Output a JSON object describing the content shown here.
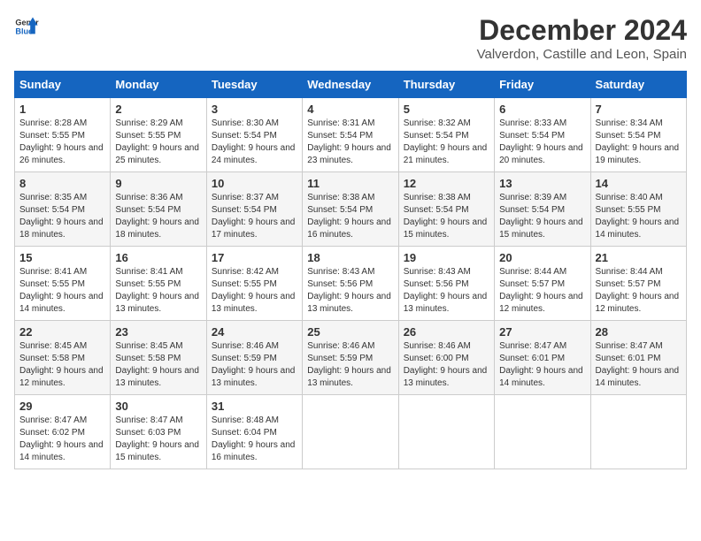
{
  "logo": {
    "text_general": "General",
    "text_blue": "Blue"
  },
  "title": "December 2024",
  "subtitle": "Valverdon, Castille and Leon, Spain",
  "days_of_week": [
    "Sunday",
    "Monday",
    "Tuesday",
    "Wednesday",
    "Thursday",
    "Friday",
    "Saturday"
  ],
  "weeks": [
    [
      {
        "day": "1",
        "sunrise": "8:28 AM",
        "sunset": "5:55 PM",
        "daylight": "9 hours and 26 minutes."
      },
      {
        "day": "2",
        "sunrise": "8:29 AM",
        "sunset": "5:55 PM",
        "daylight": "9 hours and 25 minutes."
      },
      {
        "day": "3",
        "sunrise": "8:30 AM",
        "sunset": "5:54 PM",
        "daylight": "9 hours and 24 minutes."
      },
      {
        "day": "4",
        "sunrise": "8:31 AM",
        "sunset": "5:54 PM",
        "daylight": "9 hours and 23 minutes."
      },
      {
        "day": "5",
        "sunrise": "8:32 AM",
        "sunset": "5:54 PM",
        "daylight": "9 hours and 21 minutes."
      },
      {
        "day": "6",
        "sunrise": "8:33 AM",
        "sunset": "5:54 PM",
        "daylight": "9 hours and 20 minutes."
      },
      {
        "day": "7",
        "sunrise": "8:34 AM",
        "sunset": "5:54 PM",
        "daylight": "9 hours and 19 minutes."
      }
    ],
    [
      {
        "day": "8",
        "sunrise": "8:35 AM",
        "sunset": "5:54 PM",
        "daylight": "9 hours and 18 minutes."
      },
      {
        "day": "9",
        "sunrise": "8:36 AM",
        "sunset": "5:54 PM",
        "daylight": "9 hours and 18 minutes."
      },
      {
        "day": "10",
        "sunrise": "8:37 AM",
        "sunset": "5:54 PM",
        "daylight": "9 hours and 17 minutes."
      },
      {
        "day": "11",
        "sunrise": "8:38 AM",
        "sunset": "5:54 PM",
        "daylight": "9 hours and 16 minutes."
      },
      {
        "day": "12",
        "sunrise": "8:38 AM",
        "sunset": "5:54 PM",
        "daylight": "9 hours and 15 minutes."
      },
      {
        "day": "13",
        "sunrise": "8:39 AM",
        "sunset": "5:54 PM",
        "daylight": "9 hours and 15 minutes."
      },
      {
        "day": "14",
        "sunrise": "8:40 AM",
        "sunset": "5:55 PM",
        "daylight": "9 hours and 14 minutes."
      }
    ],
    [
      {
        "day": "15",
        "sunrise": "8:41 AM",
        "sunset": "5:55 PM",
        "daylight": "9 hours and 14 minutes."
      },
      {
        "day": "16",
        "sunrise": "8:41 AM",
        "sunset": "5:55 PM",
        "daylight": "9 hours and 13 minutes."
      },
      {
        "day": "17",
        "sunrise": "8:42 AM",
        "sunset": "5:55 PM",
        "daylight": "9 hours and 13 minutes."
      },
      {
        "day": "18",
        "sunrise": "8:43 AM",
        "sunset": "5:56 PM",
        "daylight": "9 hours and 13 minutes."
      },
      {
        "day": "19",
        "sunrise": "8:43 AM",
        "sunset": "5:56 PM",
        "daylight": "9 hours and 13 minutes."
      },
      {
        "day": "20",
        "sunrise": "8:44 AM",
        "sunset": "5:57 PM",
        "daylight": "9 hours and 12 minutes."
      },
      {
        "day": "21",
        "sunrise": "8:44 AM",
        "sunset": "5:57 PM",
        "daylight": "9 hours and 12 minutes."
      }
    ],
    [
      {
        "day": "22",
        "sunrise": "8:45 AM",
        "sunset": "5:58 PM",
        "daylight": "9 hours and 12 minutes."
      },
      {
        "day": "23",
        "sunrise": "8:45 AM",
        "sunset": "5:58 PM",
        "daylight": "9 hours and 13 minutes."
      },
      {
        "day": "24",
        "sunrise": "8:46 AM",
        "sunset": "5:59 PM",
        "daylight": "9 hours and 13 minutes."
      },
      {
        "day": "25",
        "sunrise": "8:46 AM",
        "sunset": "5:59 PM",
        "daylight": "9 hours and 13 minutes."
      },
      {
        "day": "26",
        "sunrise": "8:46 AM",
        "sunset": "6:00 PM",
        "daylight": "9 hours and 13 minutes."
      },
      {
        "day": "27",
        "sunrise": "8:47 AM",
        "sunset": "6:01 PM",
        "daylight": "9 hours and 14 minutes."
      },
      {
        "day": "28",
        "sunrise": "8:47 AM",
        "sunset": "6:01 PM",
        "daylight": "9 hours and 14 minutes."
      }
    ],
    [
      {
        "day": "29",
        "sunrise": "8:47 AM",
        "sunset": "6:02 PM",
        "daylight": "9 hours and 14 minutes."
      },
      {
        "day": "30",
        "sunrise": "8:47 AM",
        "sunset": "6:03 PM",
        "daylight": "9 hours and 15 minutes."
      },
      {
        "day": "31",
        "sunrise": "8:48 AM",
        "sunset": "6:04 PM",
        "daylight": "9 hours and 16 minutes."
      },
      null,
      null,
      null,
      null
    ]
  ],
  "labels": {
    "sunrise": "Sunrise:",
    "sunset": "Sunset:",
    "daylight": "Daylight:"
  }
}
